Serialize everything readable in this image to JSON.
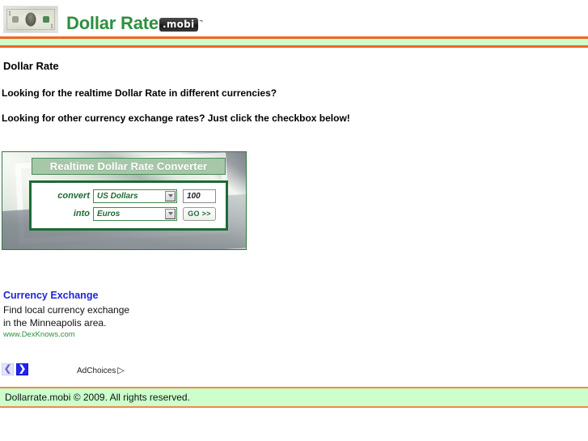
{
  "header": {
    "logo_alt": "US one dollar bill",
    "brand_text": "Dollar Rate",
    "brand_badge": "mobi",
    "badge_prefix": ".",
    "trademark": "¬"
  },
  "colors": {
    "brand_green": "#2f8f3f",
    "rule_orange": "#f26522",
    "band_green": "#ccffcc",
    "ad_link_blue": "#2222dd",
    "ad_url_green": "#2f8f3f",
    "converter_border": "#2f7a3e",
    "converter_panel_border": "#1c6b33",
    "converter_titlebar": "#a6c7a8"
  },
  "main": {
    "page_title": "Dollar Rate",
    "intro_line_1": "Looking for the realtime Dollar Rate in different currencies?",
    "intro_line_2": "Looking for other currency exchange rates? Just click the checkbox below!"
  },
  "converter": {
    "title": "Realtime Dollar Rate Converter",
    "convert_label": "convert",
    "into_label": "into",
    "from_currency": "US Dollars",
    "to_currency": "Euros",
    "amount": "100",
    "go_label": "GO >>",
    "dropdown_icon": "chevron-down-icon"
  },
  "ad": {
    "title": "Currency Exchange",
    "line_1": "Find local currency exchange",
    "line_2": "in the Minneapolis area.",
    "url": "www.DexKnows.com",
    "prev_glyph": "❮",
    "next_glyph": "❯",
    "adchoices_label": "AdChoices",
    "adchoices_glyph": "▷"
  },
  "footer": {
    "copyright": "Dollarrate.mobi © 2009. All rights reserved."
  }
}
